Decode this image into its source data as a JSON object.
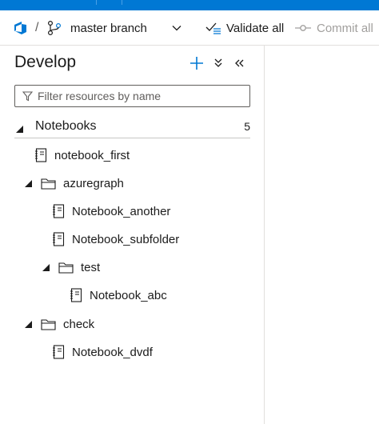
{
  "toolbar": {
    "separator": "/",
    "branch": "master branch",
    "validate_label": "Validate all",
    "commit_label": "Commit all"
  },
  "panel": {
    "title": "Develop",
    "filter_placeholder": "Filter resources by name"
  },
  "notebooks_section": {
    "label": "Notebooks",
    "count": "5"
  },
  "tree": {
    "notebook_first": "notebook_first",
    "azuregraph": "azuregraph",
    "notebook_another": "Notebook_another",
    "notebook_subfolder": "Notebook_subfolder",
    "test": "test",
    "notebook_abc": "Notebook_abc",
    "check": "check",
    "notebook_dvdf": "Notebook_dvdf"
  },
  "icons": {
    "devops": "azure-devops-icon",
    "branch": "git-branch-icon",
    "chevron": "chevron-down-icon",
    "validate": "validate-check-icon",
    "commit": "commit-icon",
    "add": "plus-icon",
    "collapse_all": "collapse-all-icon",
    "collapse_panel": "double-chevron-left-icon",
    "filter": "funnel-icon",
    "notebook": "notebook-icon",
    "folder": "folder-icon"
  },
  "colors": {
    "brand": "#0078d4",
    "text": "#1b1b1b",
    "muted": "#a19f9d"
  }
}
